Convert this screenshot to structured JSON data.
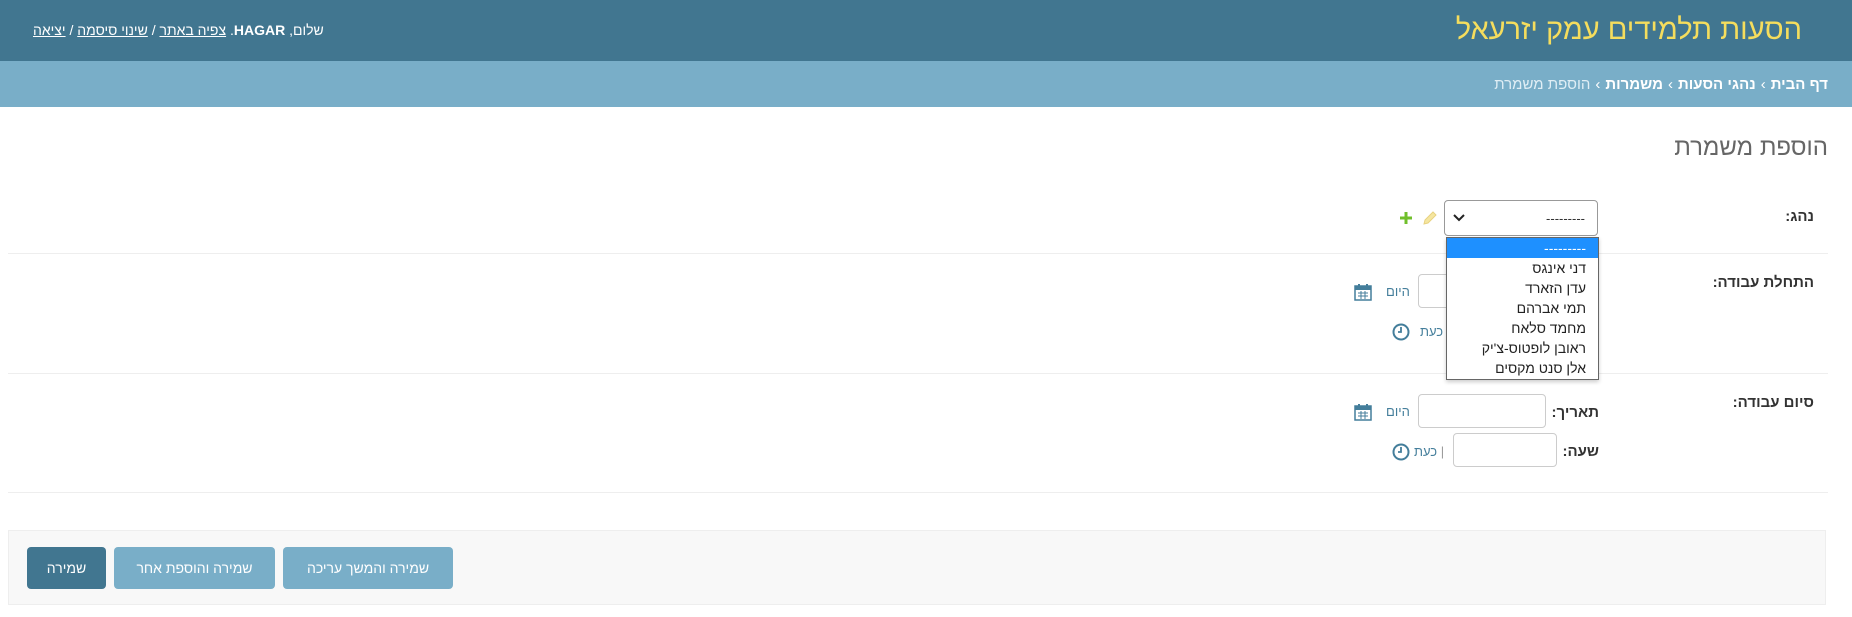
{
  "header": {
    "site_title": "הסעות תלמידים עמק יזרעאל",
    "greeting": "שלום,",
    "username": "HAGAR",
    "view_site": "צפיה באתר",
    "change_password": "שינוי סיסמה",
    "logout": "יציאה",
    "separator": "/"
  },
  "breadcrumbs": {
    "home": "דף הבית",
    "app": "נהגי הסעות",
    "model": "משמרות",
    "current": "הוספת משמרת",
    "sep": "›"
  },
  "page_title": "הוספת משמרת",
  "form": {
    "driver": {
      "label": "נהג:",
      "selected": "---------",
      "options": [
        "---------",
        "דני אינגס",
        "עדן הזארד",
        "תמי אברהם",
        "מחמד סלאח",
        "ראובן לופטוס-צ'יק",
        "אלן סנט מקסים"
      ]
    },
    "start": {
      "label": "התחלת עבודה:",
      "today_link": "היום",
      "now_link": "כעת",
      "pipe": "|"
    },
    "end": {
      "label": "סיום עבודה:",
      "date_label": "תאריך:",
      "time_label": "שעה:",
      "today_link": "היום",
      "now_link": "כעת",
      "pipe": "|"
    }
  },
  "buttons": {
    "save": "שמירה",
    "save_add_another": "שמירה והוספת אחר",
    "save_continue": "שמירה והמשך עריכה"
  },
  "icons": {
    "add": "plus-icon",
    "edit": "pencil-icon",
    "calendar": "calendar-icon",
    "clock": "clock-icon",
    "chevron": "chevron-down-icon"
  },
  "colors": {
    "header_bg": "#417690",
    "breadcrumb_bg": "#79aec8",
    "brand_text": "#f5dd5d",
    "selected_option": "#1e90ff",
    "add_green": "#70bf2b"
  }
}
